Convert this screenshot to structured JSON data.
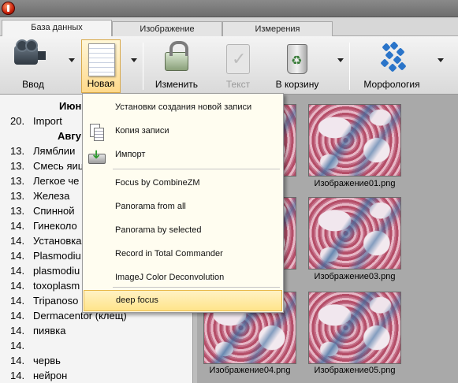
{
  "tabs": [
    {
      "label": "База данных"
    },
    {
      "label": "Изображение"
    },
    {
      "label": "Измерения"
    }
  ],
  "toolbar": {
    "input_label": "Ввод",
    "new_label": "Новая",
    "edit_label": "Изменить",
    "text_label": "Текст",
    "trash_label": "В корзину",
    "morphology_label": "Морфология"
  },
  "list": {
    "heading_june": "Июн",
    "heading_august": "Авгу",
    "rows": [
      {
        "num": "20.",
        "text": "Import"
      },
      {
        "num": "13.",
        "text": "Лямблии"
      },
      {
        "num": "13.",
        "text": "Смесь яиц"
      },
      {
        "num": "13.",
        "text": "Легкое че"
      },
      {
        "num": "13.",
        "text": "Железа"
      },
      {
        "num": "13.",
        "text": "Спинной"
      },
      {
        "num": "14.",
        "text": "Гинеколо"
      },
      {
        "num": "14.",
        "text": "Установка"
      },
      {
        "num": "14.",
        "text": "Plasmodiu"
      },
      {
        "num": "14.",
        "text": "plasmodiu"
      },
      {
        "num": "14.",
        "text": "toxoplasm"
      },
      {
        "num": "14.",
        "text": "Tripanoso"
      },
      {
        "num": "14.",
        "text": "Dermacentor (клещ)"
      },
      {
        "num": "14.",
        "text": "пиявка"
      },
      {
        "num": "14.",
        "text": ""
      },
      {
        "num": "14.",
        "text": "червь"
      },
      {
        "num": "14.",
        "text": "нейрон"
      }
    ]
  },
  "thumbnails": [
    {
      "label": ""
    },
    {
      "label": "Изображение01.png"
    },
    {
      "label": ""
    },
    {
      "label": "Изображение03.png"
    },
    {
      "label": "Изображение04.png"
    },
    {
      "label": "Изображение05.png"
    }
  ],
  "partial_label_left_row1": "png",
  "menu": {
    "items": [
      {
        "label": "Установки создания новой записи",
        "icon": ""
      },
      {
        "label": "Копия записи",
        "icon": "copy-document-icon"
      },
      {
        "label": "Импорт",
        "icon": "import-icon"
      },
      {
        "label": "Focus by CombineZM",
        "icon": ""
      },
      {
        "label": "Panorama from all",
        "icon": ""
      },
      {
        "label": "Panorama by selected",
        "icon": ""
      },
      {
        "label": "Record in Total Commander",
        "icon": ""
      },
      {
        "label": "ImageJ Color Deconvolution",
        "icon": ""
      },
      {
        "label": "deep focus",
        "icon": ""
      }
    ],
    "highlighted_index": 8
  },
  "colors": {
    "menu_highlight": "#ffe48a",
    "menu_bg": "#fffdf0",
    "toolbar_active": "#ffd98a"
  }
}
